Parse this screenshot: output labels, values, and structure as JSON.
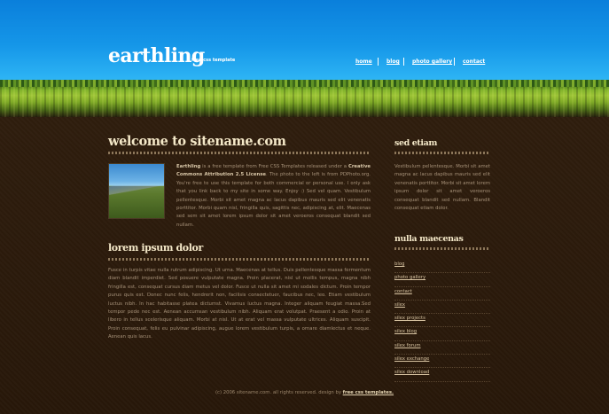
{
  "header": {
    "logo": "earthling",
    "tagline": "free css template",
    "nav": [
      "home",
      "blog",
      "photo gallery",
      "contact"
    ]
  },
  "main": {
    "welcome_title": "welcome to sitename.com",
    "intro_lead": "Earthling",
    "intro_part1": " is a free template from Free CSS Templates released under a ",
    "license": "Creative Commons Attribution 2.5 License",
    "intro_part2": ". The photo to the left is from PDPhoto.org. You're free to use this template for both commercial or personal use. I only ask that you link back to my site in some way. Enjoy :) Sed vel quam. Vestibulum pellentesque. Morbi sit amet magna ac lacus dapibus mauris sed elit venenatis porttitor. Morbi quam nisl, fringilla quis, sagittis nec, adipiscing at, elit. Maecenas sed sem sit amet lorem ipsum dolor sit amet veroeros consequat blandit sed nullam.",
    "lorem_title": "lorem ipsum dolor",
    "lorem_text": "Fusce in turpis vitae nulla rutrum adipiscing. Ut urna. Maecenas at tellus. Duis pellentesque massa fermentum diam blandit imperdiet. Sed posuere vulputate magna. Proin placerat, nisl ut mollis tempus, magna nibh fringilla est, consequat cursus diam metus vel dolor. Fusce ut nulla sit amet mi sodales dictum. Proin tempor purus quis est. Donec nunc felis, hendrerit non, facilisis consectetuer, faucibus nec, leo. Etiam vestibulum luctus nibh. In hac habitasse platea dictumst. Vivamus luctus magna. Integer aliquam feugiat massa.Sed tempor pede nec est. Aenean accumsan vestibulum nibh. Aliquam erat volutpat. Praesent a odio. Proin at libero in tellus scelerisque aliquam. Morbi at nisl. Ut at erat vel massa vulputate ultrices. Aliquam suscipit. Proin consequat, felis eu pulvinar adipiscing, augue lorem vestibulum turpis, a ornare diamlectus et neque. Aenean quis lacus."
  },
  "sidebar": {
    "sed_title": "sed etiam",
    "sed_text": "Vestibulum pellentesque. Morbi sit amet magna ac lacus dapibus mauris sed elit venenatis porttitor. Morbi sit amet lorem ipsum dolor sit amet veroeros consequat blandit sed nullam. Blandit consequat etiam dolor.",
    "nulla_title": "nulla maecenas",
    "links": [
      "blog",
      "photo gallery",
      "contact",
      "silex",
      "silex projects",
      "silex blog",
      "silex forum",
      "silex exchange",
      "silex download"
    ]
  },
  "footer": {
    "copyright": "(c) 2006 sitename.com. all rights reserved. design by ",
    "credit": "free css templates."
  }
}
